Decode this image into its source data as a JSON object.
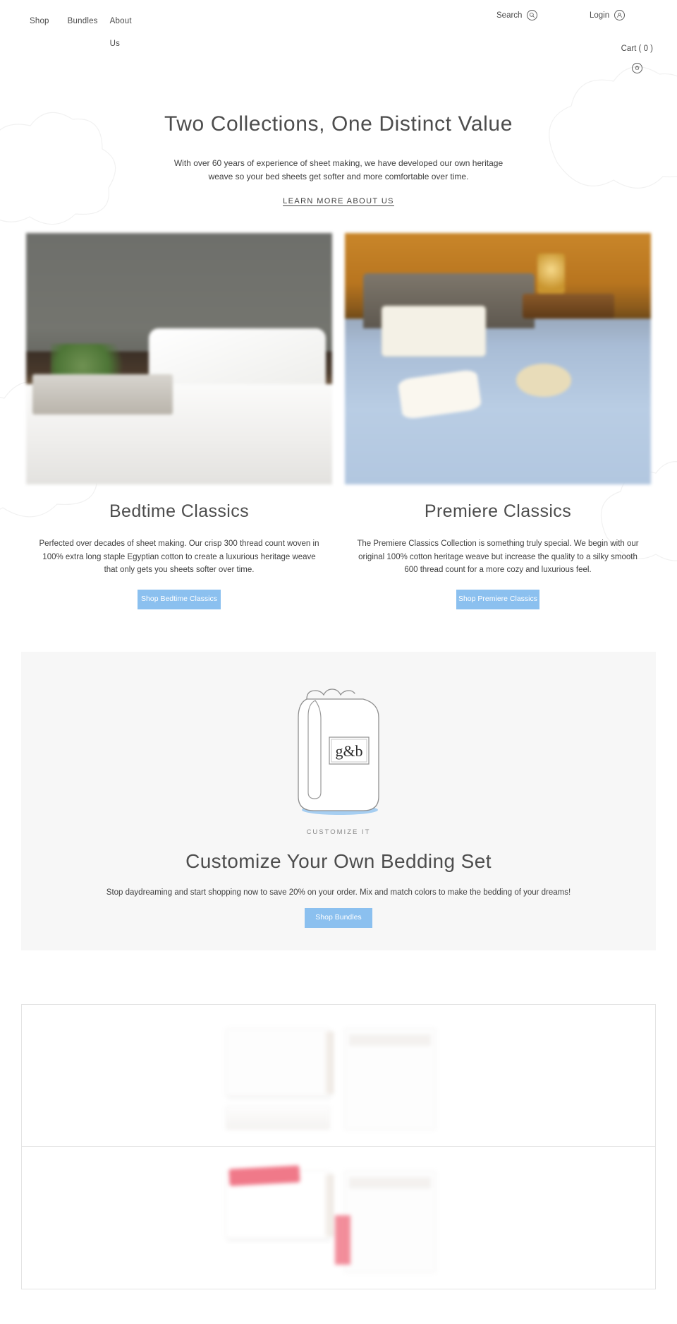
{
  "header": {
    "nav": [
      {
        "label": "Shop",
        "name": "nav-shop"
      },
      {
        "label": "Bundles",
        "name": "nav-bundles"
      },
      {
        "label": "About Us",
        "name": "nav-about-us"
      }
    ],
    "search_label": "Search",
    "login_label": "Login",
    "cart_label": "Cart ( 0 )",
    "cart_count": 0
  },
  "intro": {
    "heading": "Two Collections, One Distinct Value",
    "body": "With over 60 years of experience of sheet making, we have developed our own heritage weave so your bed sheets get softer and more comfortable over time.",
    "link_label": "LEARN MORE ABOUT US"
  },
  "collections": [
    {
      "title": "Bedtime Classics",
      "body": "Perfected over decades of sheet making. Our crisp 300 thread count woven in 100% extra long staple Egyptian cotton to create a luxurious heritage weave that only gets you sheets softer over time.",
      "button_label": "Shop Bedtime Classics",
      "image_alt": "White bed with pillows, nightstand and plant"
    },
    {
      "title": "Premiere Classics",
      "body": "The Premiere Classics Collection is something truly special.  We begin with our original 100% cotton heritage weave but increase the quality to a silky smooth 600 thread count for a more cozy and luxurious feel.",
      "button_label": "Shop Premiere Classics",
      "image_alt": "Blue bed sheets with pillow, hat and accessories"
    }
  ],
  "customize": {
    "logo_text": "g&b",
    "eyebrow": "CUSTOMIZE IT",
    "heading": "Customize Your Own Bedding Set",
    "body": "Stop daydreaming and start shopping now to save 20% on your order. Mix and match colors to make the bedding of your dreams!",
    "button_label": "Shop Bundles"
  },
  "product_panels": [
    {
      "image_alt": "White sheet set with folded sheets and pillowcase"
    },
    {
      "image_alt": "Pink and white sheet set"
    }
  ],
  "colors": {
    "button_blue": "#8bc0ef",
    "panel_grey": "#f7f7f7",
    "text": "#3f3f3f",
    "heading": "#4d4d4d",
    "border": "#e4e4e4"
  }
}
